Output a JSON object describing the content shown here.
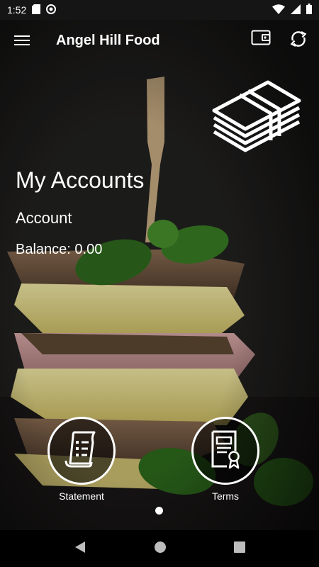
{
  "status_bar": {
    "time": "1:52",
    "icons": [
      "sd-card-icon",
      "sync-badge-icon"
    ],
    "right_icons": [
      "wifi-icon",
      "signal-icon",
      "battery-icon"
    ]
  },
  "app_bar": {
    "title": "Angel Hill Food",
    "actions": [
      "wallet-icon",
      "refresh-icon"
    ]
  },
  "accounts": {
    "heading": "My Accounts",
    "account_label": "Account",
    "balance_text": "Balance: 0.00"
  },
  "buttons": {
    "statement_label": "Statement",
    "terms_label": "Terms"
  },
  "pager": {
    "pages": 1,
    "current": 1
  },
  "nav": [
    "back-icon",
    "home-icon",
    "recents-icon"
  ],
  "colors": {
    "text": "#ffffff",
    "background": "#1b1b1b"
  }
}
